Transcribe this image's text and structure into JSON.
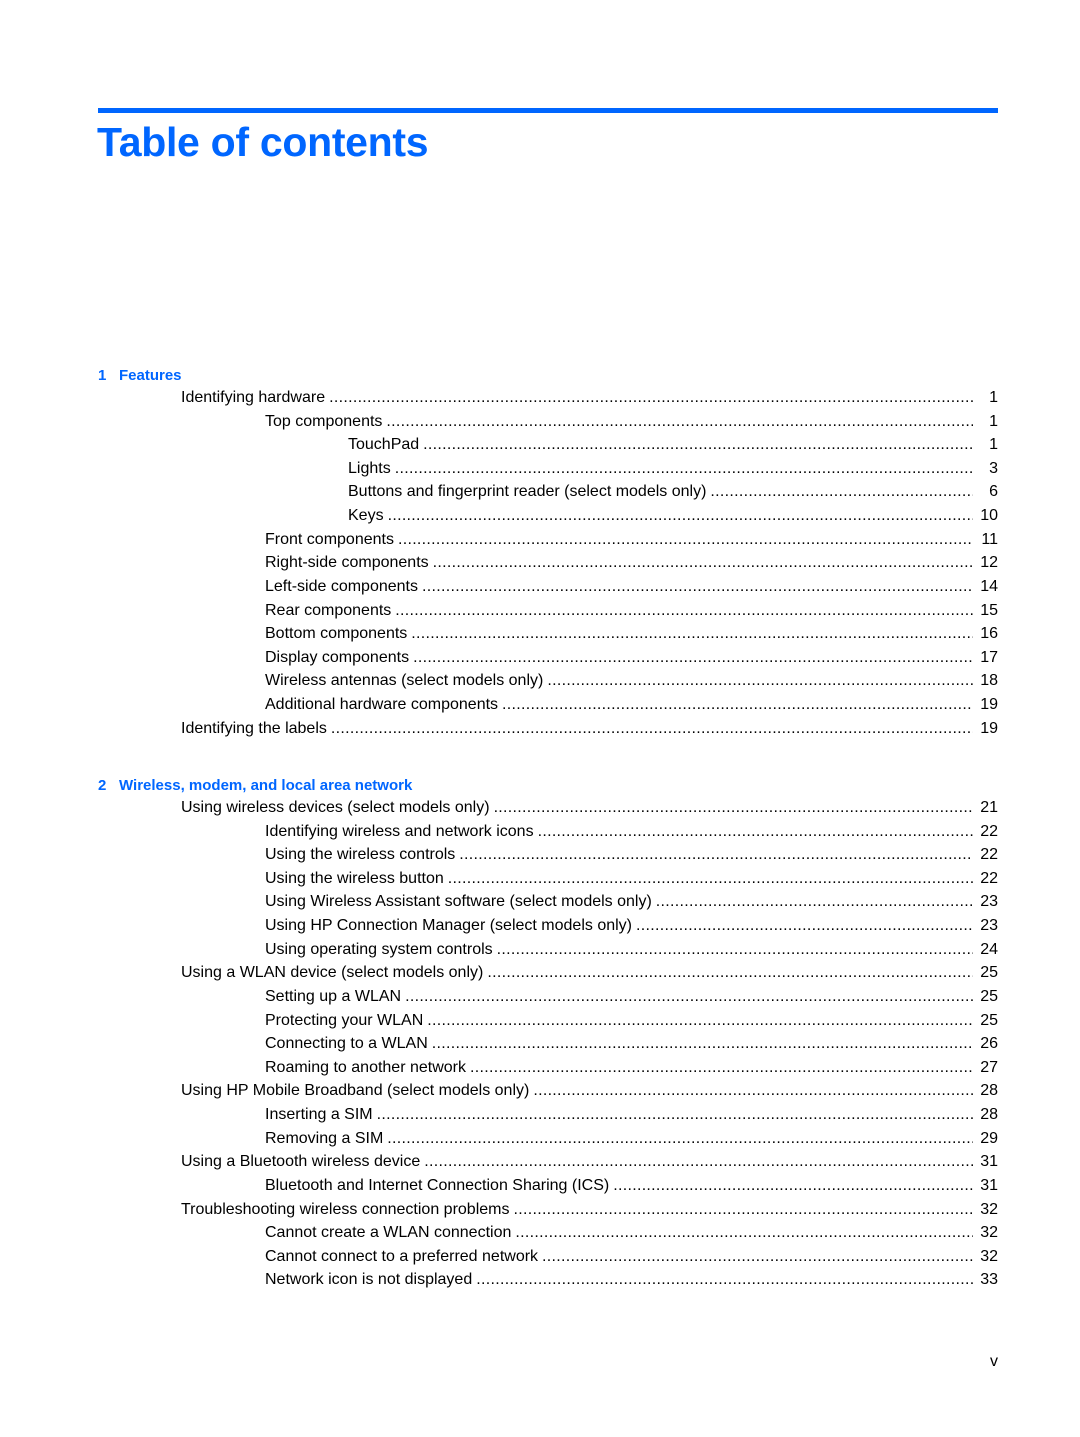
{
  "page": {
    "title": "Table of contents",
    "accent_color": "#0066ff",
    "page_number": "v"
  },
  "sections": [
    {
      "number": "1",
      "title": "Features",
      "entries": [
        {
          "level": 1,
          "label": "Identifying hardware",
          "page": "1"
        },
        {
          "level": 2,
          "label": "Top components",
          "page": "1"
        },
        {
          "level": 3,
          "label": "TouchPad",
          "page": "1"
        },
        {
          "level": 3,
          "label": "Lights",
          "page": "3"
        },
        {
          "level": 3,
          "label": "Buttons and fingerprint reader (select models only)",
          "page": "6"
        },
        {
          "level": 3,
          "label": "Keys",
          "page": "10"
        },
        {
          "level": 2,
          "label": "Front components",
          "page": "11"
        },
        {
          "level": 2,
          "label": "Right-side components",
          "page": "12"
        },
        {
          "level": 2,
          "label": "Left-side components",
          "page": "14"
        },
        {
          "level": 2,
          "label": "Rear components",
          "page": "15"
        },
        {
          "level": 2,
          "label": "Bottom components",
          "page": "16"
        },
        {
          "level": 2,
          "label": "Display components",
          "page": "17"
        },
        {
          "level": 2,
          "label": "Wireless antennas (select models only)",
          "page": "18"
        },
        {
          "level": 2,
          "label": "Additional hardware components",
          "page": "19"
        },
        {
          "level": 1,
          "label": "Identifying the labels",
          "page": "19"
        }
      ]
    },
    {
      "number": "2",
      "title": "Wireless, modem, and local area network",
      "entries": [
        {
          "level": 1,
          "label": "Using wireless devices (select models only)",
          "page": "21"
        },
        {
          "level": 2,
          "label": "Identifying wireless and network icons",
          "page": "22"
        },
        {
          "level": 2,
          "label": "Using the wireless controls",
          "page": "22"
        },
        {
          "level": 2,
          "label": "Using the wireless button",
          "page": "22"
        },
        {
          "level": 2,
          "label": "Using Wireless Assistant software (select models only)",
          "page": "23"
        },
        {
          "level": 2,
          "label": "Using HP Connection Manager (select models only)",
          "page": "23"
        },
        {
          "level": 2,
          "label": "Using operating system controls",
          "page": "24"
        },
        {
          "level": 1,
          "label": "Using a WLAN device (select models only)",
          "page": "25"
        },
        {
          "level": 2,
          "label": "Setting up a WLAN",
          "page": "25"
        },
        {
          "level": 2,
          "label": "Protecting your WLAN",
          "page": "25"
        },
        {
          "level": 2,
          "label": "Connecting to a WLAN",
          "page": "26"
        },
        {
          "level": 2,
          "label": "Roaming to another network",
          "page": "27"
        },
        {
          "level": 1,
          "label": "Using HP Mobile Broadband (select models only)",
          "page": "28"
        },
        {
          "level": 2,
          "label": "Inserting a SIM",
          "page": "28"
        },
        {
          "level": 2,
          "label": "Removing a SIM",
          "page": "29"
        },
        {
          "level": 1,
          "label": "Using a Bluetooth wireless device",
          "page": "31"
        },
        {
          "level": 2,
          "label": "Bluetooth and Internet Connection Sharing (ICS)",
          "page": "31"
        },
        {
          "level": 1,
          "label": "Troubleshooting wireless connection problems",
          "page": "32"
        },
        {
          "level": 2,
          "label": "Cannot create a WLAN connection",
          "page": "32"
        },
        {
          "level": 2,
          "label": "Cannot connect to a preferred network",
          "page": "32"
        },
        {
          "level": 2,
          "label": "Network icon is not displayed",
          "page": "33"
        }
      ]
    }
  ]
}
